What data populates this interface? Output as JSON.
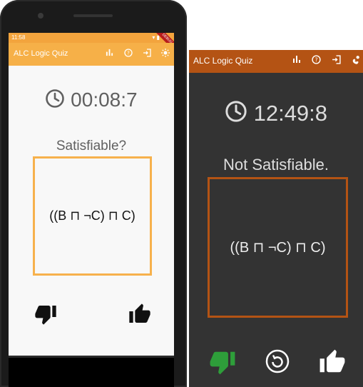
{
  "left": {
    "status_bar": {
      "time": "11:58",
      "icons": "▾ ▮",
      "debug_label": "DEBUG"
    },
    "app_bar": {
      "title": "ALC Logic Quiz",
      "color": "#f6b048",
      "actions": [
        "stats-icon",
        "help-icon",
        "logout-icon",
        "brightness-icon"
      ]
    },
    "timer": "00:08:7",
    "question": "Satisfiable?",
    "formula": "((B ⊓ ¬C) ⊓ C)",
    "accent": "#f7b14c",
    "buttons": [
      "thumb-down-icon",
      "thumb-up-icon"
    ]
  },
  "right": {
    "app_bar": {
      "title": "ALC Logic Quiz",
      "color": "#b45314",
      "actions": [
        "stats-icon",
        "help-icon",
        "logout-icon",
        "theme-icon"
      ]
    },
    "timer": "12:49:8",
    "status": "Not Satisfiable.",
    "formula": "((B ⊓ ¬C) ⊓ C)",
    "accent": "#b45314",
    "answer_color": "#2e9e3a",
    "buttons": [
      "thumb-down-icon",
      "retry-icon",
      "thumb-up-icon"
    ]
  }
}
